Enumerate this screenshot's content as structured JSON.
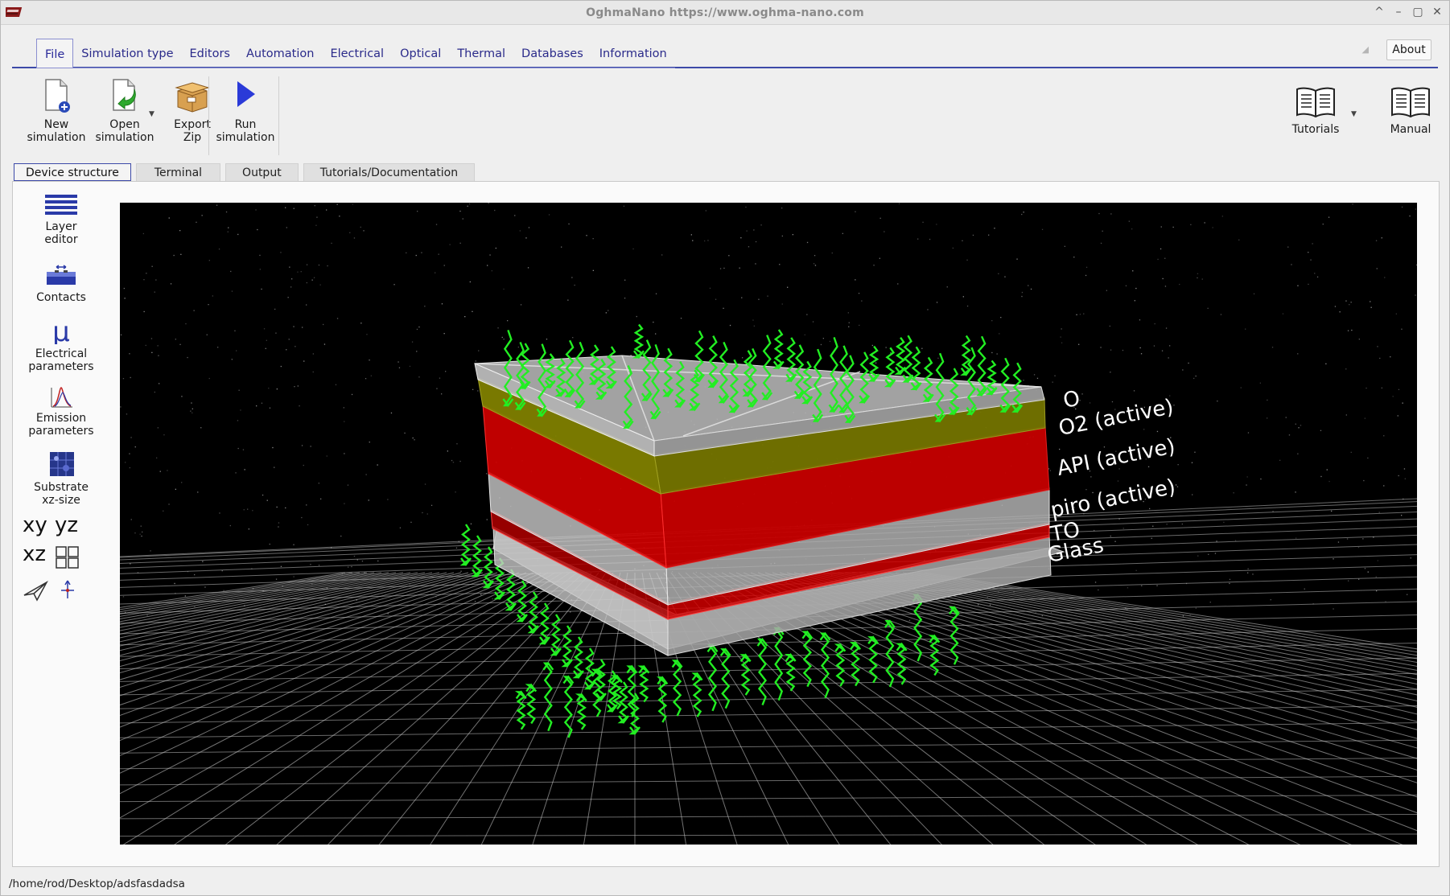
{
  "window": {
    "title": "OghmaNano https://www.oghma-nano.com",
    "controls": [
      "^",
      "–",
      "▢",
      "✕"
    ]
  },
  "menu": {
    "tabs": [
      {
        "label": "File",
        "active": true
      },
      {
        "label": "Simulation type"
      },
      {
        "label": "Editors"
      },
      {
        "label": "Automation"
      },
      {
        "label": "Electrical"
      },
      {
        "label": "Optical"
      },
      {
        "label": "Thermal"
      },
      {
        "label": "Databases"
      },
      {
        "label": "Information"
      }
    ],
    "about": "About"
  },
  "ribbon": {
    "new_simulation": "New\nsimulation",
    "open_simulation": "Open\nsimulation",
    "export_zip": "Export\nZip",
    "run_simulation": "Run\nsimulation",
    "tutorials": "Tutorials",
    "manual": "Manual"
  },
  "subtabs": [
    {
      "label": "Device structure",
      "active": true
    },
    {
      "label": "Terminal"
    },
    {
      "label": "Output"
    },
    {
      "label": "Tutorials/Documentation"
    }
  ],
  "sidebar": {
    "layer_editor": "Layer\neditor",
    "contacts": "Contacts",
    "electrical_parameters": "Electrical\nparameters",
    "emission_parameters": "Emission\nparameters",
    "substrate_size": "Substrate\nxz-size",
    "view_xy": "xy",
    "view_yz": "yz",
    "view_xz": "xz"
  },
  "layer_labels": [
    {
      "text": "O"
    },
    {
      "text": "O2 (active)"
    },
    {
      "text": "API (active)"
    },
    {
      "text": "piro (active)"
    },
    {
      "text": "TO"
    },
    {
      "text": "Glass"
    }
  ],
  "colors": {
    "accent": "#3d4aa8",
    "yellow_layer": "#7a7a00",
    "red_layer": "#c40000",
    "grey_layer": "#b8b8b8",
    "photon": "#22ee22"
  },
  "status": {
    "path": "/home/rod/Desktop/adsfasdadsa"
  }
}
